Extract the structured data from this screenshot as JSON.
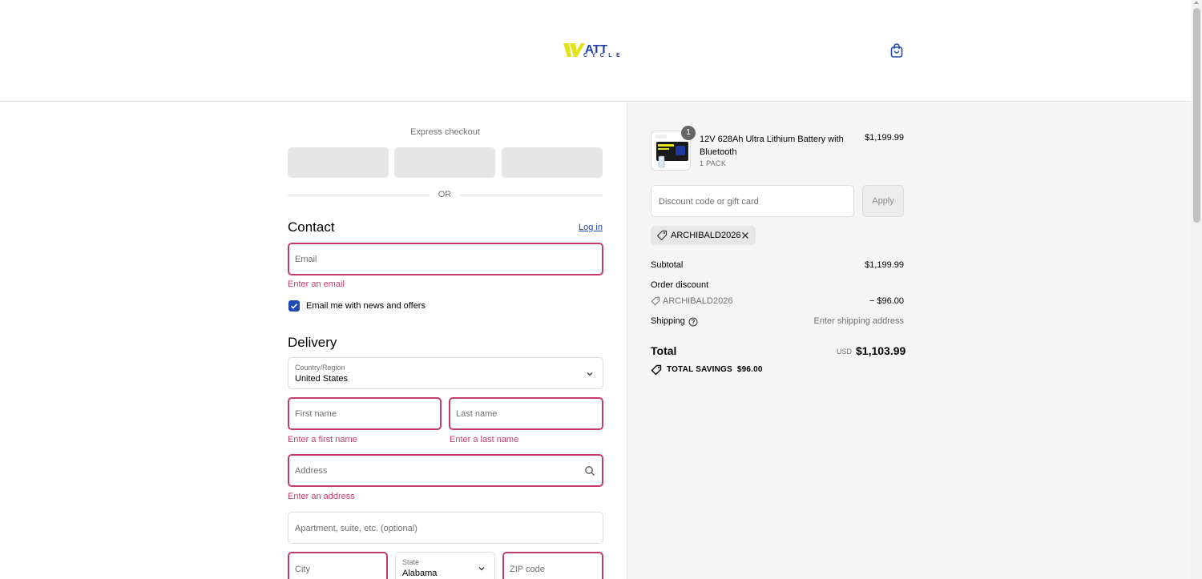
{
  "header": {
    "logo_text": "ATT",
    "logo_subtext": "CYCLE",
    "cart_icon": "shopping-bag-icon"
  },
  "express": {
    "label": "Express checkout",
    "divider": "OR"
  },
  "contact": {
    "title": "Contact",
    "login_link": "Log in",
    "email_placeholder": "Email",
    "email_error": "Enter an email",
    "newsletter_label": "Email me with news and offers",
    "newsletter_checked": true
  },
  "delivery": {
    "title": "Delivery",
    "country_label": "Country/Region",
    "country_value": "United States",
    "first_name_placeholder": "First name",
    "first_name_error": "Enter a first name",
    "last_name_placeholder": "Last name",
    "last_name_error": "Enter a last name",
    "address_placeholder": "Address",
    "address_error": "Enter an address",
    "apartment_placeholder": "Apartment, suite, etc. (optional)",
    "city_placeholder": "City",
    "state_label": "State",
    "state_value": "Alabama",
    "zip_placeholder": "ZIP code"
  },
  "order": {
    "item": {
      "quantity": "1",
      "name": "12V 628Ah Ultra Lithium Battery with Bluetooth",
      "variant": "1 PACK",
      "price": "$1,199.99"
    },
    "discount_placeholder": "Discount code or gift card",
    "apply_label": "Apply",
    "applied_code": "ARCHIBALD2026",
    "subtotal_label": "Subtotal",
    "subtotal_value": "$1,199.99",
    "order_discount_label": "Order discount",
    "discount_code": "ARCHIBALD2026",
    "discount_value": "− $96.00",
    "shipping_label": "Shipping",
    "shipping_value": "Enter shipping address",
    "total_label": "Total",
    "total_currency": "USD",
    "total_value": "$1,103.99",
    "savings_label": "TOTAL SAVINGS",
    "savings_value": "$96.00"
  },
  "colors": {
    "accent": "#1f49b5",
    "error": "#c23d6b",
    "logo_yellow": "#e3e01c",
    "logo_blue": "#1f3a9e"
  }
}
